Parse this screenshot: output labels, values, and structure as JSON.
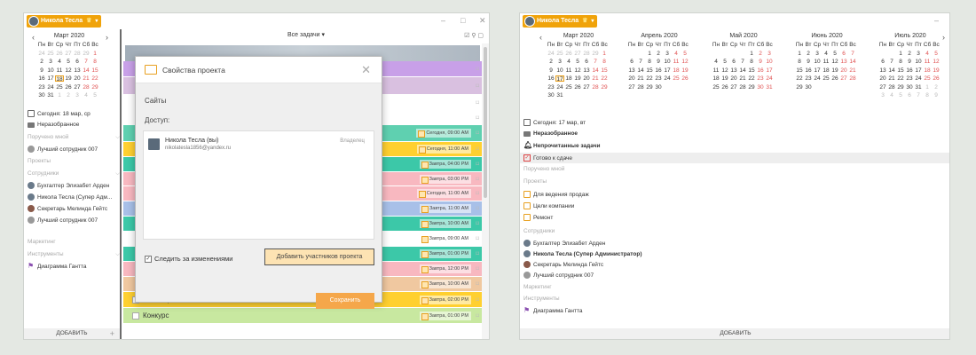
{
  "user": {
    "name": "Никола Тесла",
    "crown": "♛",
    "caret": "▾"
  },
  "win1": {
    "month_title": "Март 2020",
    "prev": "‹",
    "next": "›",
    "weekdays": [
      "Пн",
      "Вт",
      "Ср",
      "Чт",
      "Пт",
      "Сб",
      "Вс"
    ],
    "days": [
      [
        "24",
        "o"
      ],
      [
        "25",
        "o"
      ],
      [
        "26",
        "o"
      ],
      [
        "27",
        "o"
      ],
      [
        "28",
        "o"
      ],
      [
        "29",
        "o"
      ],
      [
        "1",
        "we"
      ],
      [
        "2",
        ""
      ],
      [
        "3",
        ""
      ],
      [
        "4",
        ""
      ],
      [
        "5",
        ""
      ],
      [
        "6",
        ""
      ],
      [
        "7",
        "we"
      ],
      [
        "8",
        "we"
      ],
      [
        "9",
        ""
      ],
      [
        "10",
        ""
      ],
      [
        "11",
        ""
      ],
      [
        "12",
        ""
      ],
      [
        "13",
        ""
      ],
      [
        "14",
        "we"
      ],
      [
        "15",
        "we"
      ],
      [
        "16",
        ""
      ],
      [
        "17",
        ""
      ],
      [
        "18",
        "td"
      ],
      [
        "19",
        ""
      ],
      [
        "20",
        ""
      ],
      [
        "21",
        "we"
      ],
      [
        "22",
        "we"
      ],
      [
        "23",
        ""
      ],
      [
        "24",
        ""
      ],
      [
        "25",
        ""
      ],
      [
        "26",
        ""
      ],
      [
        "27",
        ""
      ],
      [
        "28",
        "we"
      ],
      [
        "29",
        "we"
      ],
      [
        "30",
        ""
      ],
      [
        "31",
        ""
      ],
      [
        "1",
        "o"
      ],
      [
        "2",
        "o"
      ],
      [
        "3",
        "o"
      ],
      [
        "4",
        "o"
      ],
      [
        "5",
        "o"
      ]
    ],
    "today": "Сегодня: 18 мар, ср",
    "unsorted": "Неразобранное",
    "assigned": "Поручено мной",
    "assigned_user": "Лучший сотрудник 007",
    "projects": "Проекты",
    "staff": "Сотрудники",
    "staff_list": [
      "Бухгалтер Элизабет Арден",
      "Никола Тесла (Супер Адм...",
      "Секретарь Мелинда Гейтс",
      "Лучший сотрудник 007"
    ],
    "marketing": "Маркетинг",
    "tools": "Инструменты",
    "gantt": "Диаграмма Гантта",
    "add": "ДОБАВИТЬ",
    "plus": "+",
    "filter": "Все задачи ▾",
    "rows": [
      {
        "color": "#c8a0e8",
        "name": "",
        "due": ""
      },
      {
        "color": "#d9c0e0",
        "name": "",
        "due": ""
      },
      {
        "color": "#ffffff",
        "name": "",
        "due": ""
      },
      {
        "color": "#ffffff",
        "name": "",
        "due": ""
      },
      {
        "color": "#5fd0b0",
        "name": "",
        "due": "Сегодня, 09:00 AM"
      },
      {
        "color": "#ffd030",
        "name": "",
        "due": "Сегодня, 11:00 AM"
      },
      {
        "color": "#3cc8a8",
        "name": "",
        "due": "Завтра, 04:00 PM"
      },
      {
        "color": "#f8b8c0",
        "name": "",
        "due": "Завтра, 03:00 PM"
      },
      {
        "color": "#f8b8c0",
        "name": "",
        "due": "Сегодня, 11:00 AM"
      },
      {
        "color": "#a8c0e8",
        "name": "",
        "due": "Завтра, 11:00 AM"
      },
      {
        "color": "#3cc8a8",
        "name": "",
        "due": "Завтра, 10:00 AM"
      },
      {
        "color": "#ffffff",
        "name": "",
        "due": "Завтра, 09:00 AM"
      },
      {
        "color": "#3cc8a8",
        "name": "",
        "due": "Завтра, 01:00 PM"
      },
      {
        "color": "#f8b8c0",
        "name": "",
        "due": "Завтра, 12:00 PM"
      },
      {
        "color": "#f0c8a0",
        "name": "",
        "due": "Завтра, 10:00 AM"
      },
      {
        "color": "#ffd030",
        "name": "Заказ промо",
        "due": "Завтра, 02:00 PM"
      },
      {
        "color": "#c8e8a0",
        "name": "Конкурс",
        "due": "Завтра, 01:00 PM"
      }
    ],
    "dialog": {
      "title": "Свойства проекта",
      "sites": "Сайты",
      "access": "Доступ:",
      "user_name": "Никола Тесла (вы)",
      "user_email": "nikolatesla1856@yandex.ru",
      "role": "Владелец",
      "follow": "Следить за изменениями",
      "add_members": "Добавить участников проекта",
      "save": "Сохранить",
      "close": "✕"
    }
  },
  "win2": {
    "weekdays": [
      "Пн",
      "Вт",
      "Ср",
      "Чт",
      "Пт",
      "Сб",
      "Вс"
    ],
    "prev": "‹",
    "next": "›",
    "months": [
      {
        "title": "Март 2020",
        "days": [
          [
            "24",
            "o"
          ],
          [
            "25",
            "o"
          ],
          [
            "26",
            "o"
          ],
          [
            "27",
            "o"
          ],
          [
            "28",
            "o"
          ],
          [
            "29",
            "o"
          ],
          [
            "1",
            "we"
          ],
          [
            "2",
            ""
          ],
          [
            "3",
            ""
          ],
          [
            "4",
            ""
          ],
          [
            "5",
            ""
          ],
          [
            "6",
            ""
          ],
          [
            "7",
            "we"
          ],
          [
            "8",
            "we"
          ],
          [
            "9",
            ""
          ],
          [
            "10",
            ""
          ],
          [
            "11",
            ""
          ],
          [
            "12",
            ""
          ],
          [
            "13",
            ""
          ],
          [
            "14",
            "we"
          ],
          [
            "15",
            "we"
          ],
          [
            "16",
            ""
          ],
          [
            "17",
            "td"
          ],
          [
            "18",
            ""
          ],
          [
            "19",
            ""
          ],
          [
            "20",
            ""
          ],
          [
            "21",
            "we"
          ],
          [
            "22",
            "we"
          ],
          [
            "23",
            ""
          ],
          [
            "24",
            ""
          ],
          [
            "25",
            ""
          ],
          [
            "26",
            ""
          ],
          [
            "27",
            ""
          ],
          [
            "28",
            "we"
          ],
          [
            "29",
            "we"
          ],
          [
            "30",
            ""
          ],
          [
            "31",
            ""
          ]
        ]
      },
      {
        "title": "Апрель 2020",
        "days": [
          [
            "",
            ""
          ],
          [
            "",
            ""
          ],
          [
            "1",
            ""
          ],
          [
            "2",
            ""
          ],
          [
            "3",
            ""
          ],
          [
            "4",
            "we"
          ],
          [
            "5",
            "we"
          ],
          [
            "6",
            ""
          ],
          [
            "7",
            ""
          ],
          [
            "8",
            ""
          ],
          [
            "9",
            ""
          ],
          [
            "10",
            ""
          ],
          [
            "11",
            "we"
          ],
          [
            "12",
            "we"
          ],
          [
            "13",
            ""
          ],
          [
            "14",
            ""
          ],
          [
            "15",
            ""
          ],
          [
            "16",
            ""
          ],
          [
            "17",
            ""
          ],
          [
            "18",
            "we"
          ],
          [
            "19",
            "we"
          ],
          [
            "20",
            ""
          ],
          [
            "21",
            ""
          ],
          [
            "22",
            ""
          ],
          [
            "23",
            ""
          ],
          [
            "24",
            ""
          ],
          [
            "25",
            "we"
          ],
          [
            "26",
            "we"
          ],
          [
            "27",
            ""
          ],
          [
            "28",
            ""
          ],
          [
            "29",
            ""
          ],
          [
            "30",
            ""
          ]
        ]
      },
      {
        "title": "Май 2020",
        "days": [
          [
            "",
            ""
          ],
          [
            "",
            ""
          ],
          [
            "",
            ""
          ],
          [
            "",
            ""
          ],
          [
            "1",
            ""
          ],
          [
            "2",
            "we"
          ],
          [
            "3",
            "we"
          ],
          [
            "4",
            ""
          ],
          [
            "5",
            ""
          ],
          [
            "6",
            ""
          ],
          [
            "7",
            ""
          ],
          [
            "8",
            ""
          ],
          [
            "9",
            "we"
          ],
          [
            "10",
            "we"
          ],
          [
            "11",
            ""
          ],
          [
            "12",
            ""
          ],
          [
            "13",
            ""
          ],
          [
            "14",
            ""
          ],
          [
            "15",
            ""
          ],
          [
            "16",
            "we"
          ],
          [
            "17",
            "we"
          ],
          [
            "18",
            ""
          ],
          [
            "19",
            ""
          ],
          [
            "20",
            ""
          ],
          [
            "21",
            ""
          ],
          [
            "22",
            ""
          ],
          [
            "23",
            "we"
          ],
          [
            "24",
            "we"
          ],
          [
            "25",
            ""
          ],
          [
            "26",
            ""
          ],
          [
            "27",
            ""
          ],
          [
            "28",
            ""
          ],
          [
            "29",
            ""
          ],
          [
            "30",
            "we"
          ],
          [
            "31",
            "we"
          ]
        ]
      },
      {
        "title": "Июнь 2020",
        "days": [
          [
            "1",
            ""
          ],
          [
            "2",
            ""
          ],
          [
            "3",
            ""
          ],
          [
            "4",
            ""
          ],
          [
            "5",
            ""
          ],
          [
            "6",
            "we"
          ],
          [
            "7",
            "we"
          ],
          [
            "8",
            ""
          ],
          [
            "9",
            ""
          ],
          [
            "10",
            ""
          ],
          [
            "11",
            ""
          ],
          [
            "12",
            ""
          ],
          [
            "13",
            "we"
          ],
          [
            "14",
            "we"
          ],
          [
            "15",
            ""
          ],
          [
            "16",
            ""
          ],
          [
            "17",
            ""
          ],
          [
            "18",
            ""
          ],
          [
            "19",
            ""
          ],
          [
            "20",
            "we"
          ],
          [
            "21",
            "we"
          ],
          [
            "22",
            ""
          ],
          [
            "23",
            ""
          ],
          [
            "24",
            ""
          ],
          [
            "25",
            ""
          ],
          [
            "26",
            ""
          ],
          [
            "27",
            "we"
          ],
          [
            "28",
            "we"
          ],
          [
            "29",
            ""
          ],
          [
            "30",
            ""
          ]
        ]
      },
      {
        "title": "Июль 2020",
        "days": [
          [
            "",
            ""
          ],
          [
            "",
            ""
          ],
          [
            "1",
            ""
          ],
          [
            "2",
            ""
          ],
          [
            "3",
            ""
          ],
          [
            "4",
            "we"
          ],
          [
            "5",
            "we"
          ],
          [
            "6",
            ""
          ],
          [
            "7",
            ""
          ],
          [
            "8",
            ""
          ],
          [
            "9",
            ""
          ],
          [
            "10",
            ""
          ],
          [
            "11",
            "we"
          ],
          [
            "12",
            "we"
          ],
          [
            "13",
            ""
          ],
          [
            "14",
            ""
          ],
          [
            "15",
            ""
          ],
          [
            "16",
            ""
          ],
          [
            "17",
            ""
          ],
          [
            "18",
            "we"
          ],
          [
            "19",
            "we"
          ],
          [
            "20",
            ""
          ],
          [
            "21",
            ""
          ],
          [
            "22",
            ""
          ],
          [
            "23",
            ""
          ],
          [
            "24",
            ""
          ],
          [
            "25",
            "we"
          ],
          [
            "26",
            "we"
          ],
          [
            "27",
            ""
          ],
          [
            "28",
            ""
          ],
          [
            "29",
            ""
          ],
          [
            "30",
            ""
          ],
          [
            "31",
            ""
          ],
          [
            "1",
            "o"
          ],
          [
            "2",
            "o"
          ],
          [
            "3",
            "o"
          ],
          [
            "4",
            "o"
          ],
          [
            "5",
            "o"
          ],
          [
            "6",
            "o"
          ],
          [
            "7",
            "o"
          ],
          [
            "8",
            "o"
          ],
          [
            "9",
            "o"
          ]
        ]
      }
    ],
    "today": "Сегодня: 17 мар, вт",
    "unsorted": "Неразобранное",
    "unread": "Непрочитанные задачи",
    "ready": "Готово к сдаче",
    "assigned": "Поручено мной",
    "projects": "Проекты",
    "project_list": [
      "Для ведения продаж",
      "Цели компании",
      "Ремонт"
    ],
    "staff": "Сотрудники",
    "staff_list": [
      "Бухгалтер Элизабет Арден",
      "Никола Тесла (Супер Администратор)",
      "Секретарь Мелинда Гейтс",
      "Лучший сотрудник 007"
    ],
    "marketing": "Маркетинг",
    "tools": "Инструменты",
    "gantt": "Диаграмма Гантта",
    "add": "ДОБАВИТЬ"
  }
}
